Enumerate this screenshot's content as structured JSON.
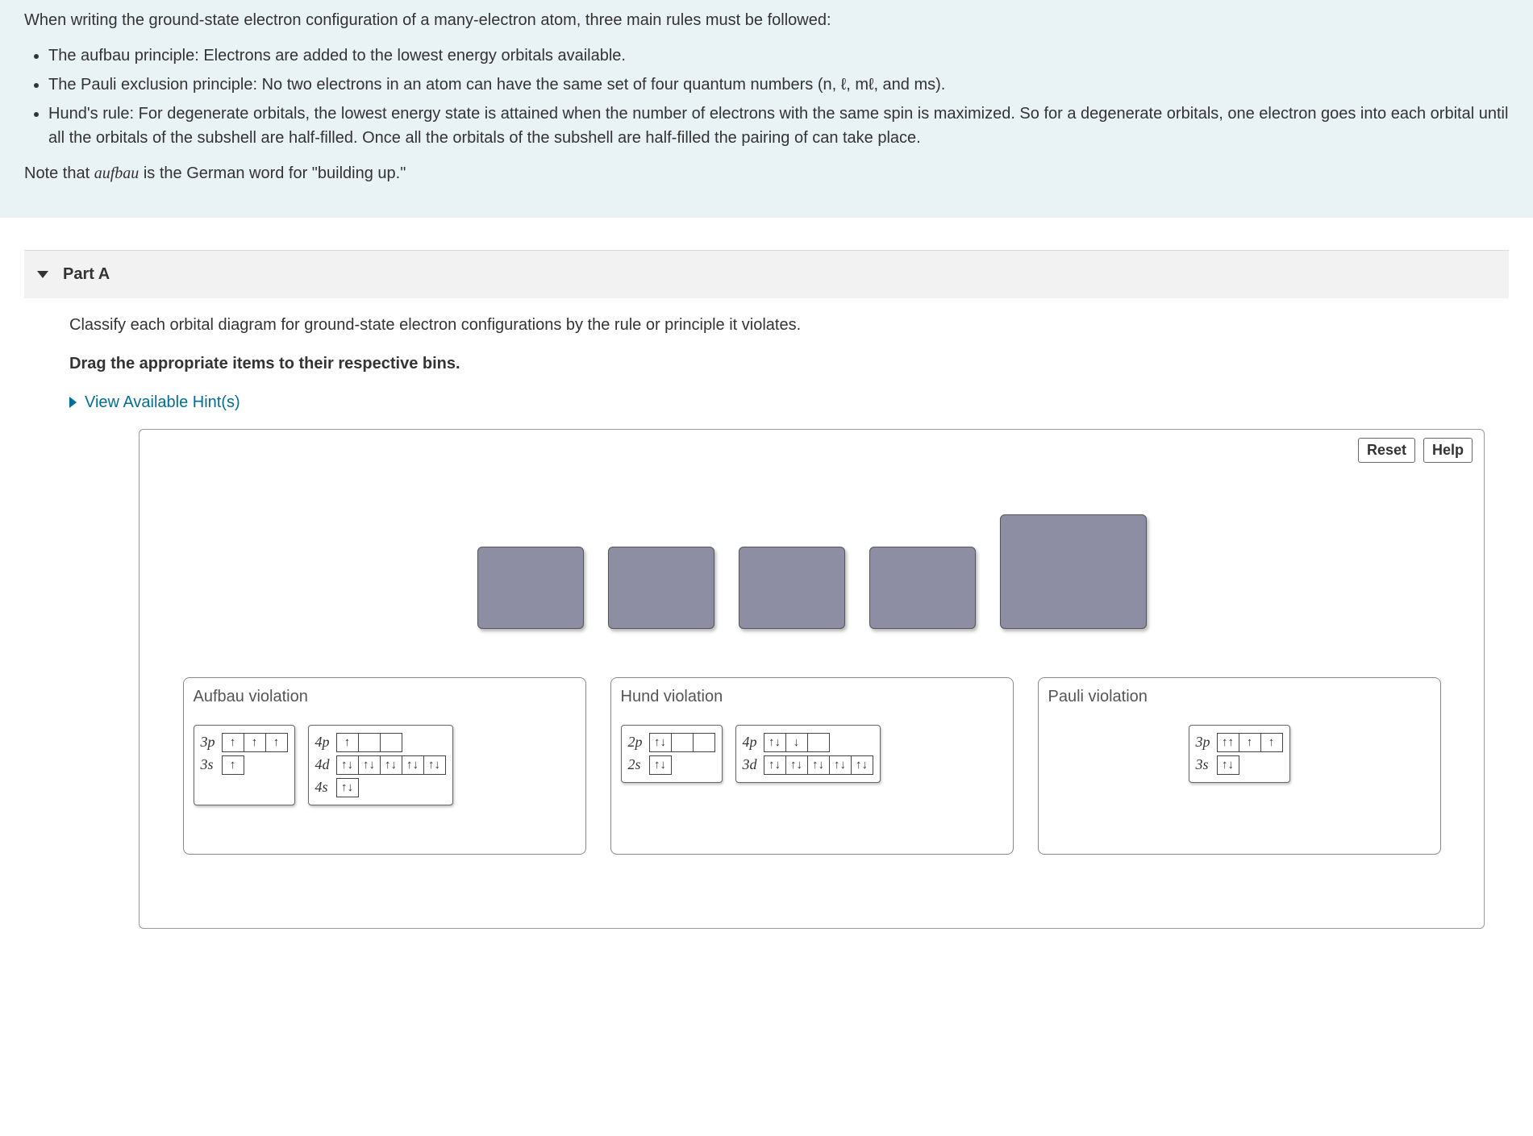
{
  "intro": {
    "lead": "When writing the ground-state electron configuration of a many-electron atom, three main rules must be followed:",
    "bullets": [
      "The aufbau principle: Electrons are added to the lowest energy orbitals available.",
      "The Pauli exclusion principle:  No two electrons in an atom can have the same set of four quantum numbers (n, ℓ, mℓ, and ms).",
      "Hund's rule: For degenerate orbitals, the lowest energy state is attained when the number of electrons with the same spin is maximized. So for a degenerate orbitals, one electron goes into each orbital until all the orbitals of the subshell are half-filled. Once all the orbitals of the subshell are half-filled the pairing of can take place."
    ],
    "note_prefix": "Note that ",
    "note_word": "aufbau",
    "note_suffix": " is the German word for \"building up.\""
  },
  "part_header": "Part A",
  "question": "Classify each orbital diagram for ground-state electron configurations by the rule or principle it violates.",
  "instruction2": "Drag the appropriate items to their respective bins.",
  "hints_label": "View Available Hint(s)",
  "buttons": {
    "reset": "Reset",
    "help": "Help"
  },
  "bins": [
    {
      "label": "Aufbau violation"
    },
    {
      "label": "Hund violation"
    },
    {
      "label": "Pauli violation"
    }
  ],
  "cards": {
    "aufbau1": {
      "rows": [
        {
          "label": "3p",
          "boxes": [
            "↑",
            "↑",
            "↑"
          ]
        },
        {
          "label": "3s",
          "boxes": [
            "↑"
          ]
        }
      ]
    },
    "aufbau2": {
      "rows": [
        {
          "label": "4p",
          "boxes": [
            "↑",
            "",
            ""
          ]
        },
        {
          "label": "4d",
          "boxes": [
            "↑↓",
            "↑↓",
            "↑↓",
            "↑↓",
            "↑↓"
          ]
        },
        {
          "label": "4s",
          "boxes": [
            "↑↓"
          ]
        }
      ]
    },
    "hund1": {
      "rows": [
        {
          "label": "2p",
          "boxes": [
            "↑↓",
            "",
            ""
          ]
        },
        {
          "label": "2s",
          "boxes": [
            "↑↓"
          ]
        }
      ]
    },
    "hund2": {
      "rows": [
        {
          "label": "4p",
          "boxes": [
            "↑↓",
            "↓",
            ""
          ]
        },
        {
          "label": "3d",
          "boxes": [
            "↑↓",
            "↑↓",
            "↑↓",
            "↑↓",
            "↑↓"
          ]
        }
      ]
    },
    "pauli1": {
      "rows": [
        {
          "label": "3p",
          "boxes": [
            "↑↑",
            "↑",
            "↑"
          ]
        },
        {
          "label": "3s",
          "boxes": [
            "↑↓"
          ]
        }
      ]
    }
  }
}
